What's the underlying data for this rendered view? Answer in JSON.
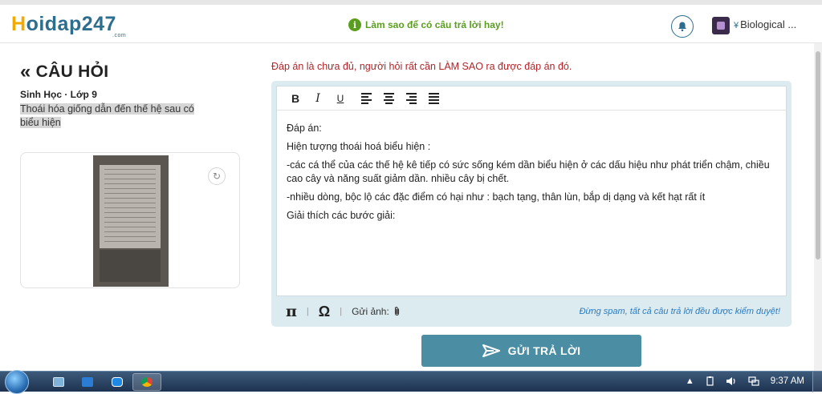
{
  "header": {
    "logo_h": "H",
    "logo_rest": "oidap247",
    "logo_com": ".com",
    "tip": "Làm sao để có câu trả lời hay!",
    "user_name": "Biological ..."
  },
  "question": {
    "title": "CÂU HỎI",
    "subject": "Sinh Học · Lớp 9",
    "text_line1": "Thoái hóa giống dẫn đến thế hệ sau có",
    "text_line2": "biểu hiện"
  },
  "answer": {
    "notice": "Đáp án là chưa đủ, người hỏi rất cần LÀM SAO ra được đáp án đó.",
    "toolbar": {
      "bold": "B",
      "italic": "I",
      "underline": "U"
    },
    "lines": [
      "Đáp án:",
      "Hiện tượng thoái hoá biểu hiện :",
      "-các cá thể của các thế hệ kê tiếp có sức sống kém dần biểu hiện ở các dấu hiệu như phát triển chậm, chiều cao cây và năng suất giảm dần. nhiều cây bị chết.",
      "-nhiều dòng, bộc lộ các đặc điểm có hại như : bạch tạng, thân lùn, bắp dị dạng và kết hạt rất ít",
      "Giải thích các bước giải:"
    ],
    "footer": {
      "pi": "π",
      "omega": "Ω",
      "attach_label": "Gửi ảnh:",
      "spam_note": "Đừng spam, tất cả câu trả lời đều được kiểm duyệt!"
    },
    "submit_label": "GỬI TRẢ LỜI"
  },
  "taskbar": {
    "clock": "9:37 AM",
    "tray_arrow": "▲"
  },
  "colors": {
    "brand": "#2d6e8e",
    "logo_accent": "#f2a900",
    "tip_green": "#5a9e1e",
    "notice_red": "#b0252a",
    "submit_bg": "#4b8ea3"
  }
}
